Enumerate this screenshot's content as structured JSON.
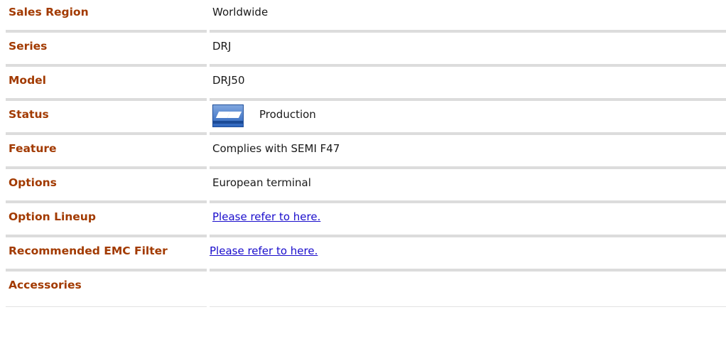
{
  "rows": [
    {
      "label": "Sales Region",
      "value": "Worldwide"
    },
    {
      "label": "Series",
      "value": "DRJ"
    },
    {
      "label": "Model",
      "value": "DRJ50"
    },
    {
      "label": "Status",
      "value": "Production",
      "icon": "production-status-icon"
    },
    {
      "label": "Feature",
      "value": "Complies with SEMI F47"
    },
    {
      "label": "Options",
      "value": "European terminal"
    },
    {
      "label": "Option Lineup",
      "value": "Please refer to here.",
      "link": true
    },
    {
      "label": "Recommended EMC Filter",
      "value": "Please refer to here.",
      "link": true
    },
    {
      "label": "Accessories",
      "value": ""
    }
  ],
  "colors": {
    "label": "#a23a00",
    "link": "#1a0dcc",
    "separator": "#dcdcdc",
    "icon_blue": "#2d65bd"
  }
}
